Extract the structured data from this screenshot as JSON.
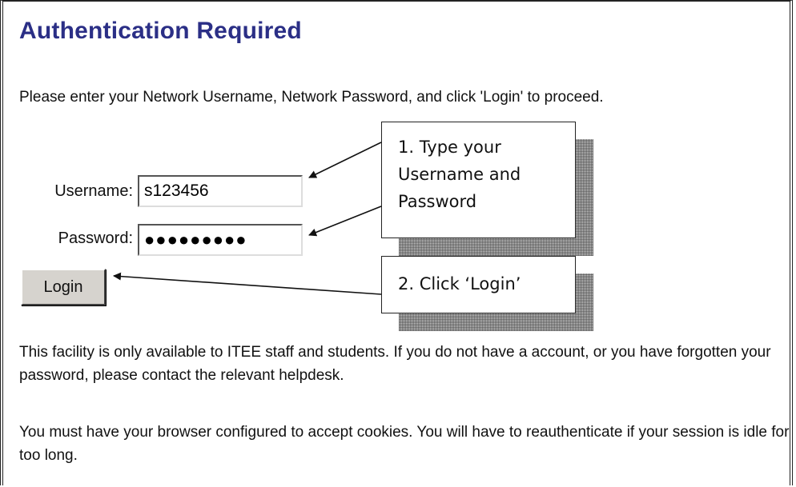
{
  "page": {
    "title": "Authentication Required",
    "intro": "Please enter your Network Username, Network Password, and click 'Login' to proceed."
  },
  "form": {
    "username_label": "Username:",
    "username_value": "s123456",
    "password_label": "Password:",
    "password_value": "●●●●●●●●●",
    "login_label": "Login"
  },
  "callouts": {
    "step1": "1. Type your Username and Password",
    "step1_lines": [
      "1. Type your",
      "Username and",
      "Password"
    ],
    "step2": "2. Click ‘Login’"
  },
  "notes": {
    "access": "This facility is only available to ITEE staff and students. If you do not have a account, or you have forgotten your password, please contact the relevant helpdesk.",
    "cookies": "You must have your browser configured to accept cookies. You will have to reauthenticate if your session is idle for too long."
  },
  "colors": {
    "title": "#2b2f86",
    "button_face": "#d6d3ce",
    "callout_border": "#222222"
  }
}
